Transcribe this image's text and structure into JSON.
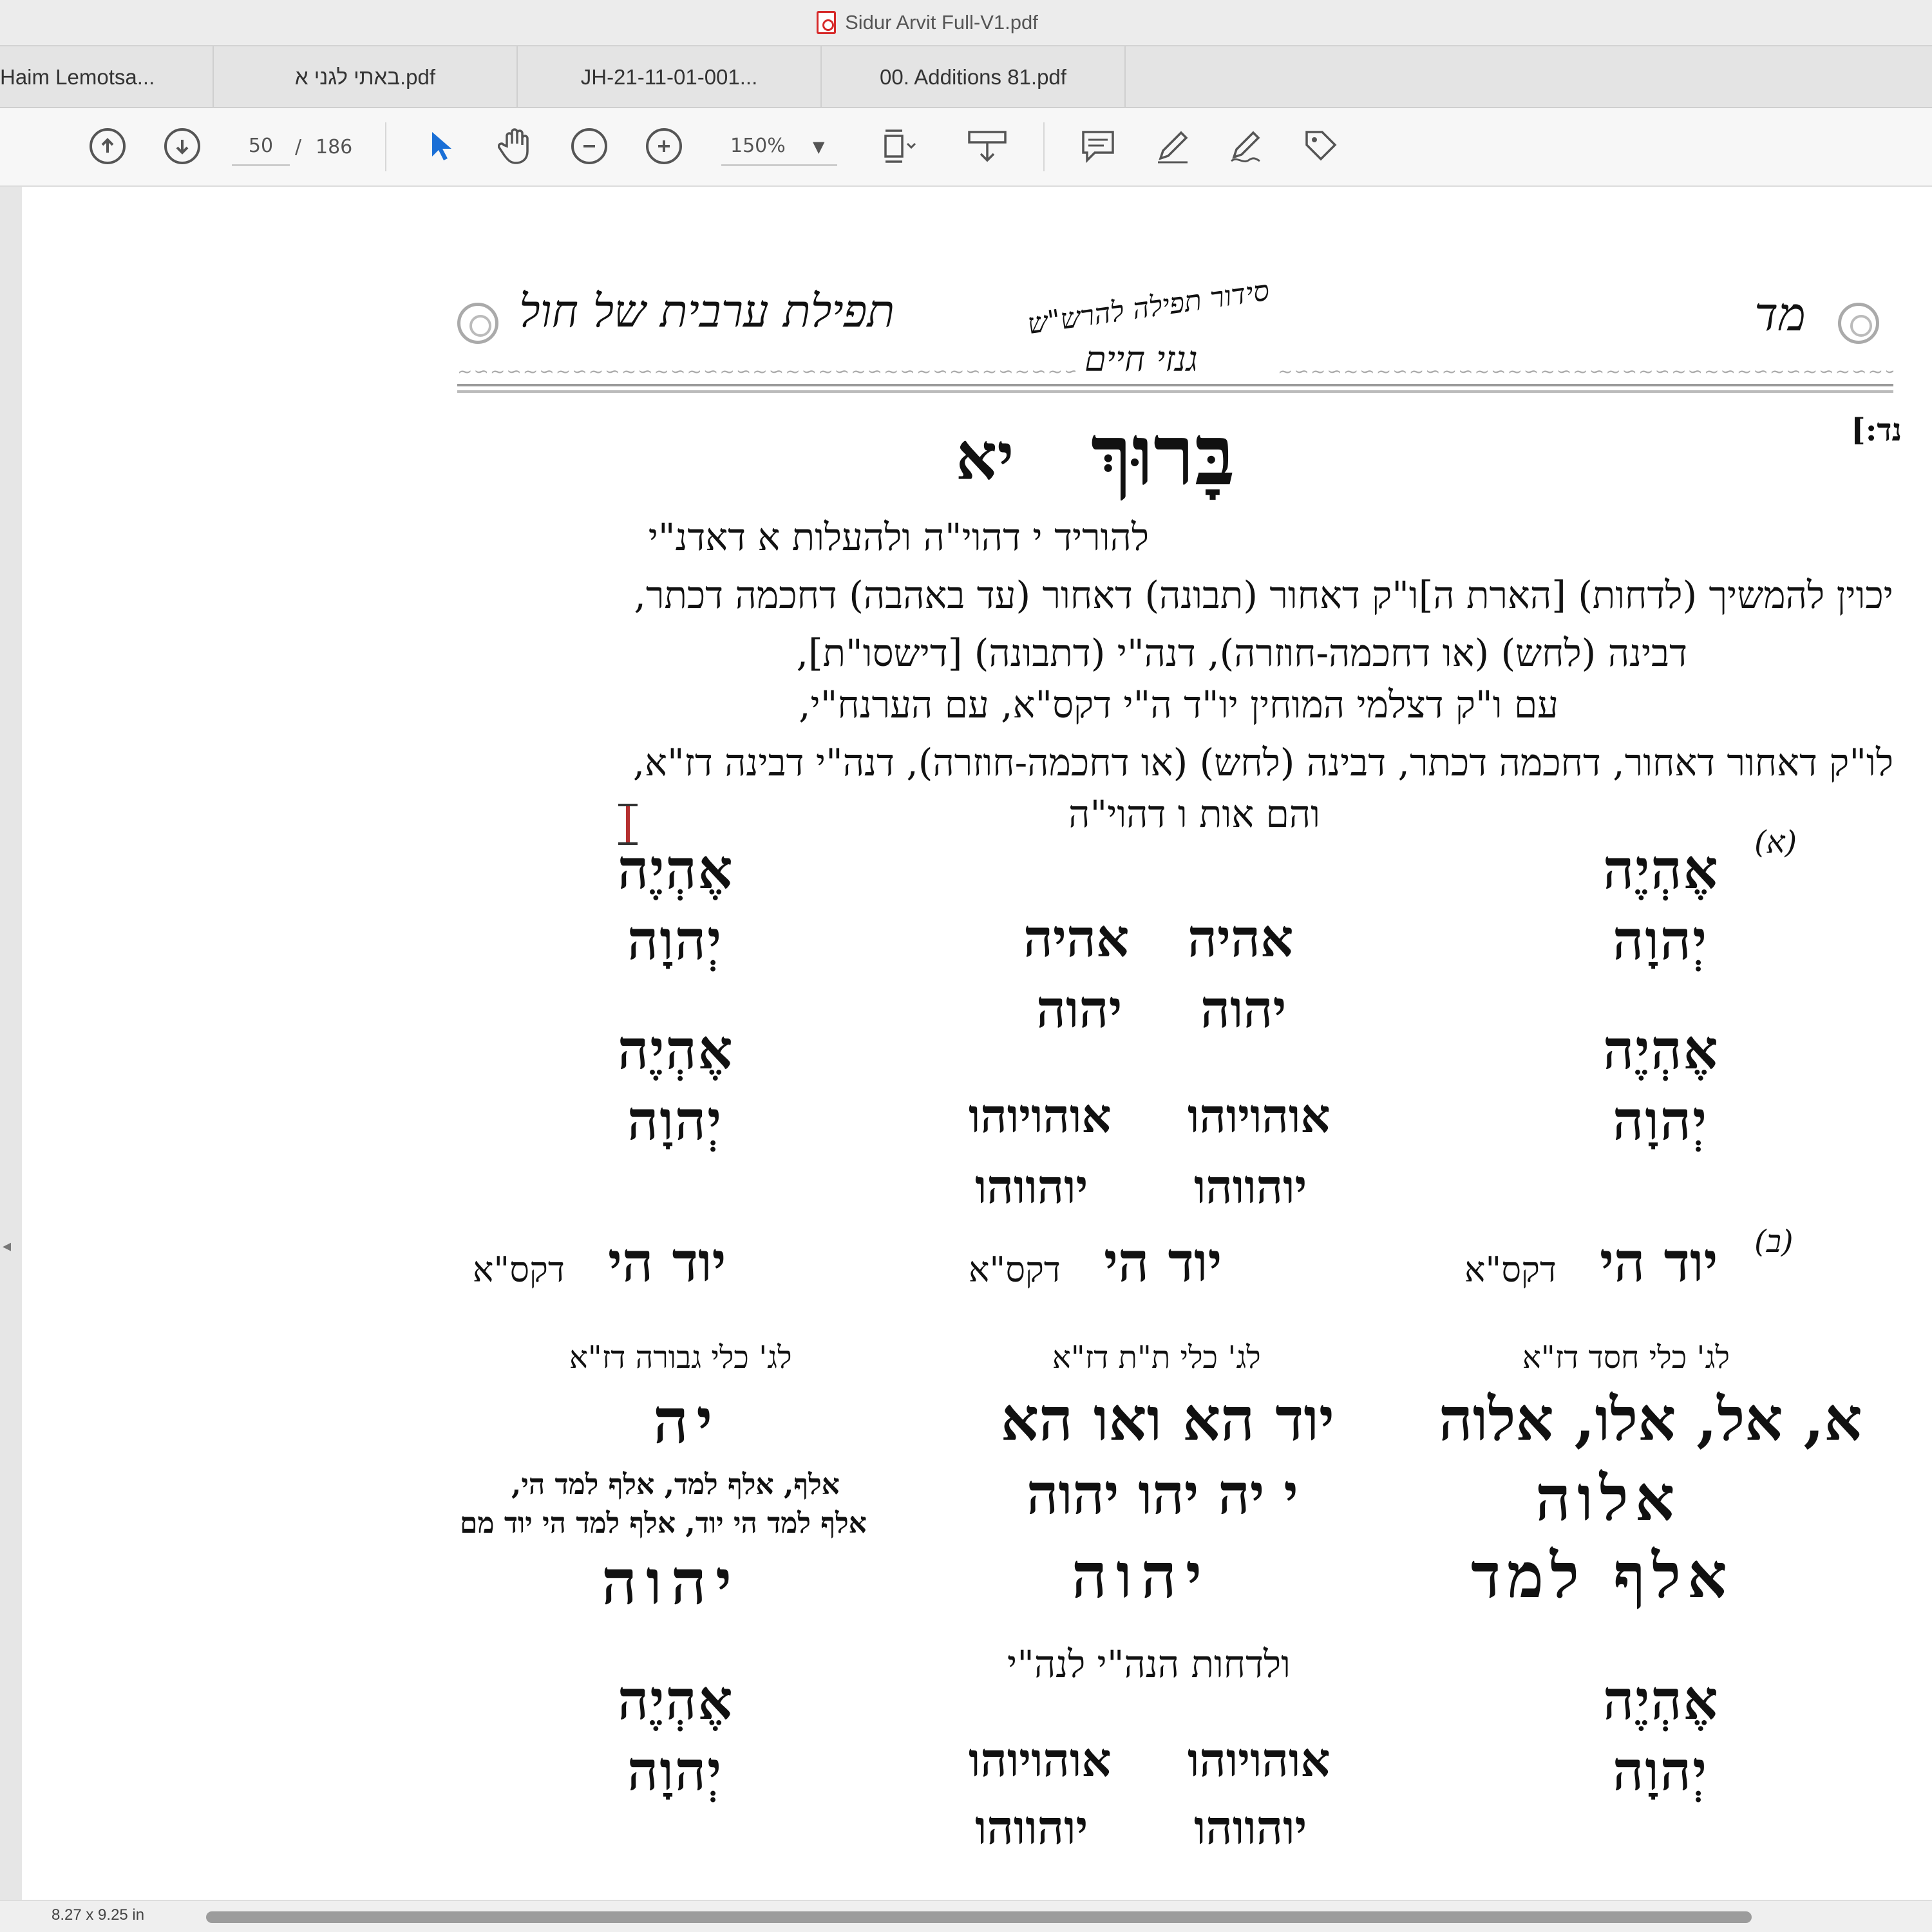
{
  "window": {
    "title": "Sidur Arvit Full-V1.pdf"
  },
  "tabs": [
    {
      "label": "Haim Lemotsa..."
    },
    {
      "label": "באתי לגני א.pdf"
    },
    {
      "label": "JH-21-11-01-001..."
    },
    {
      "label": "00. Additions 81.pdf"
    }
  ],
  "toolbar": {
    "page_current": "50",
    "page_separator": "/",
    "page_total": "186",
    "zoom": "150%"
  },
  "status": {
    "page_size": "8.27 x 9.25 in"
  },
  "document": {
    "header_left": "תפילת ערבית של חול",
    "header_center_top": "סידור תפילה להרש\"ש",
    "header_center_bottom": "גנזי חיים",
    "header_right": "מד",
    "side_ref": "נד:]",
    "title_main": "בָּרוּךְ",
    "title_mark": "יא",
    "line1": "להוריד י דהוי\"ה ולהעלות א דאדנ\"י",
    "line2": "יכוין להמשיך (לדחות) [הארת ה]ו\"ק דאחור (תבונה) דאחור (עד באהבה) דחכמה דכתר,",
    "line3": "דבינה (לחש) (או דחכמה-חוזרה), דנה\"י (דתבונה) [דישסו\"ת],",
    "line4": "עם ו\"ק דצלמי המוחין יו\"ד ה\"י דקס\"א, עם הערנח\"י,",
    "line5": "לו\"ק דאחור דאחור, דחכמה דכתר, דבינה (לחש) (או דחכמה-חוזרה), דנה\"י דבינה דז\"א,",
    "line6": "והם אות ו דהוי\"ה",
    "mark_a": "(א)",
    "mark_b": "(ב)",
    "ehyeh": "אֶהְיֶה",
    "havayah": "יְהוָה",
    "ehyeh_plain": "אהיה",
    "havayah_plain": "יהוה",
    "combo1": "אוהויוהו",
    "combo2": "יוהווהו",
    "yod_hey": "יוד הי",
    "daksa": "דקס\"א",
    "keli_chesed": "לג' כלי חסד דז\"א",
    "keli_tiferet": "לג' כלי ת\"ת דז\"א",
    "keli_gevurah": "לג' כלי גבורה דז\"א",
    "el_seq": "א, אל, אלו, אלוה",
    "eloha": "אלוה",
    "aleph_lamed": "אלף למד",
    "yod_he_vav": "יוד הא ואו הא",
    "yud_seq": "י יה יהו יהוה",
    "yhvh_long": "יהוה",
    "yah": "יה",
    "aleph_note1": "אלף, אלף למד, אלף למד הי,",
    "aleph_note2": "אלף למד הי יוד, אלף למד הי יוד מם",
    "lidchot": "ולדחות הנה\"י לנה\"י"
  }
}
